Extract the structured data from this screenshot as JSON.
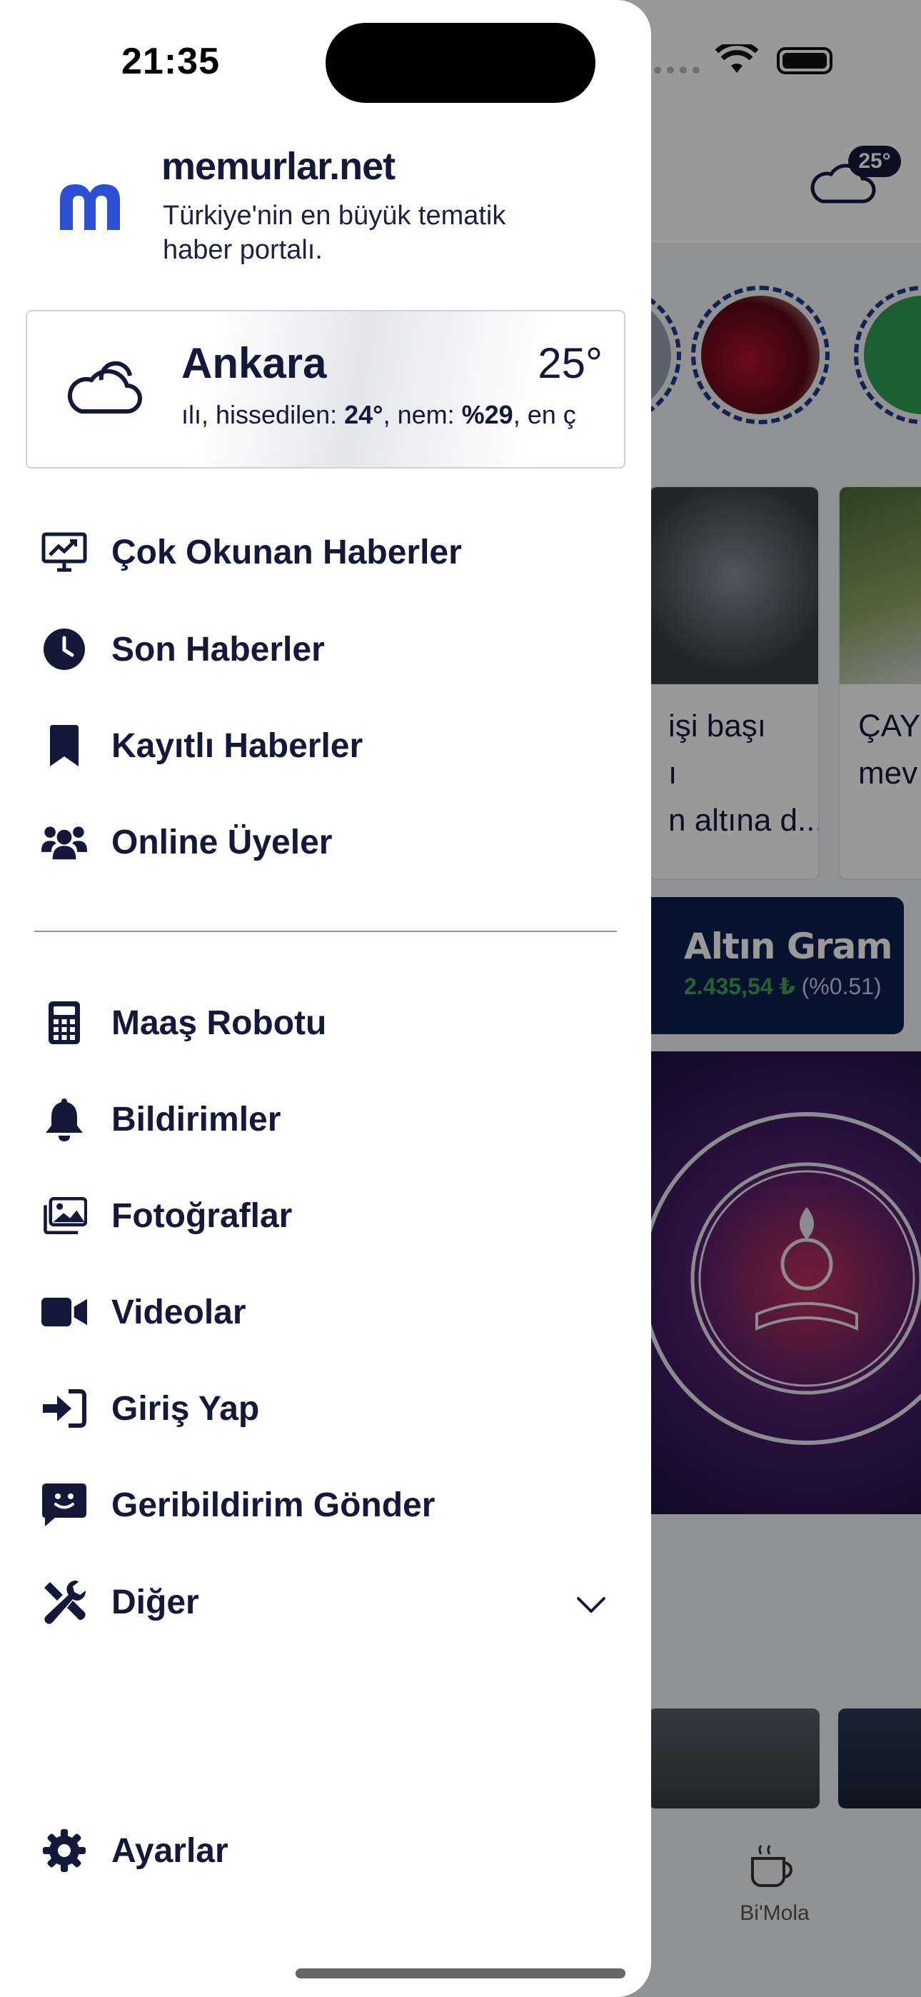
{
  "status_bar": {
    "time": "21:35"
  },
  "background": {
    "header_temp": "25°",
    "cards": [
      {
        "lines": [
          "işi başı",
          "ı",
          "n altına d..."
        ]
      },
      {
        "lines": [
          "ÇAY",
          "mev"
        ]
      }
    ],
    "gold": {
      "title": "Altın Gram",
      "value": "2.435,54 ₺",
      "change": "(%0.51)"
    },
    "tab_label": "Bi'Mola"
  },
  "drawer": {
    "site_name": "memurlar.net",
    "tagline": "Türkiye'nin en büyük tematik haber portalı.",
    "weather": {
      "city": "Ankara",
      "temp": "25°",
      "detail_prefix": "ılı, hissedilen: ",
      "feels": "24°",
      "detail_mid": ", nem: ",
      "humidity": "%29",
      "detail_suffix": ", en ç"
    },
    "menu_top": [
      {
        "label": "Çok Okunan Haberler",
        "icon": "trending-monitor-icon"
      },
      {
        "label": "Son Haberler",
        "icon": "clock-icon"
      },
      {
        "label": "Kayıtlı Haberler",
        "icon": "bookmark-icon"
      },
      {
        "label": "Online Üyeler",
        "icon": "users-icon"
      }
    ],
    "menu_bottom": [
      {
        "label": "Maaş Robotu",
        "icon": "calculator-icon"
      },
      {
        "label": "Bildirimler",
        "icon": "bell-icon"
      },
      {
        "label": "Fotoğraflar",
        "icon": "images-icon"
      },
      {
        "label": "Videolar",
        "icon": "video-icon"
      },
      {
        "label": "Giriş Yap",
        "icon": "login-icon"
      },
      {
        "label": "Geribildirim Gönder",
        "icon": "feedback-icon"
      },
      {
        "label": "Diğer",
        "icon": "tools-icon"
      }
    ],
    "settings": {
      "label": "Ayarlar",
      "icon": "gear-icon"
    }
  },
  "colors": {
    "navy": "#14193a",
    "logo_blue": "#2d4fd6",
    "gold_green": "#3fa34d"
  }
}
